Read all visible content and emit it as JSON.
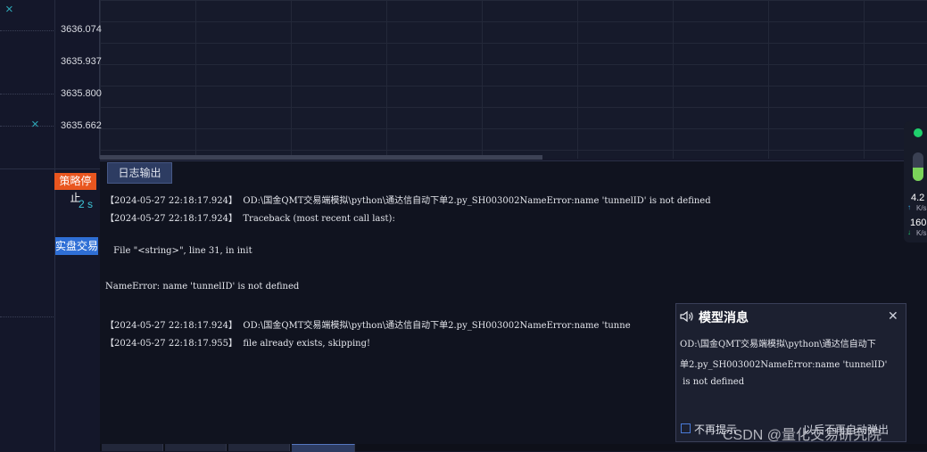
{
  "chart": {
    "y_labels": [
      "3636.074",
      "3635.937",
      "3635.800",
      "3635.662"
    ],
    "x_markers": [
      "×",
      "×"
    ]
  },
  "strategy": {
    "stop_button": "策略停止",
    "interval": "2 s",
    "live_button": "实盘交易"
  },
  "log": {
    "tab_label": "日志输出",
    "lines": [
      "【2024-05-27 22:18:17.924】  OD:\\国金QMT交易端模拟\\python\\通达信自动下单2.py_SH003002NameError:name 'tunnelID' is not defined",
      "【2024-05-27 22:18:17.924】  Traceback (most recent call last):",
      "",
      " File \"<string>\", line 31, in init",
      "",
      "NameError: name 'tunnelID' is not defined",
      "",
      "【2024-05-27 22:18:17.924】  OD:\\国金QMT交易端模拟\\python\\通达信自动下单2.py_SH003002NameError:name 'tunne",
      "【2024-05-27 22:18:17.955】  file already exists, skipping!"
    ]
  },
  "speed_widget": {
    "upload_value": "4.2",
    "upload_unit": "K/s",
    "download_value": "160",
    "download_unit": "K/s"
  },
  "popup": {
    "title": "模型消息",
    "close": "✕",
    "message_lines": [
      "OD:\\国金QMT交易端模拟\\python\\通达信自动下",
      "单2.py_SH003002NameError:name 'tunnelID'",
      " is not defined"
    ],
    "dont_remind": "不再提示",
    "action": "以后不再自动弹出"
  },
  "watermark": "CSDN @量化交易研究院",
  "colors": {
    "stop": "#e9561f",
    "live": "#2f6fd6",
    "accent": "#3ec6d8",
    "green": "#1fd06c"
  }
}
